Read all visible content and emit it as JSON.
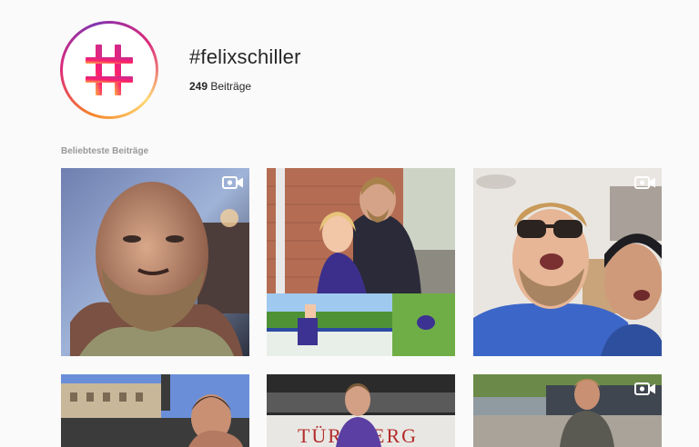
{
  "header": {
    "hashtag": "#felixschiller",
    "post_count": "249",
    "post_label": "Beiträge",
    "hashtag_icon": "hashtag-icon"
  },
  "section": {
    "label": "Beliebteste Beiträge"
  },
  "posts": [
    {
      "type": "video",
      "icon": "video-camera-icon"
    },
    {
      "type": "photo"
    },
    {
      "type": "video",
      "icon": "video-camera-icon"
    },
    {
      "type": "photo"
    },
    {
      "type": "photo",
      "visible_text": "TÜREBERG"
    },
    {
      "type": "video",
      "icon": "video-camera-icon"
    }
  ],
  "colors": {
    "gradient_start": "#feda77",
    "gradient_mid": "#dd2a7b",
    "gradient_end": "#8134af",
    "background": "#fafafa",
    "text": "#262626",
    "muted": "#999999"
  }
}
